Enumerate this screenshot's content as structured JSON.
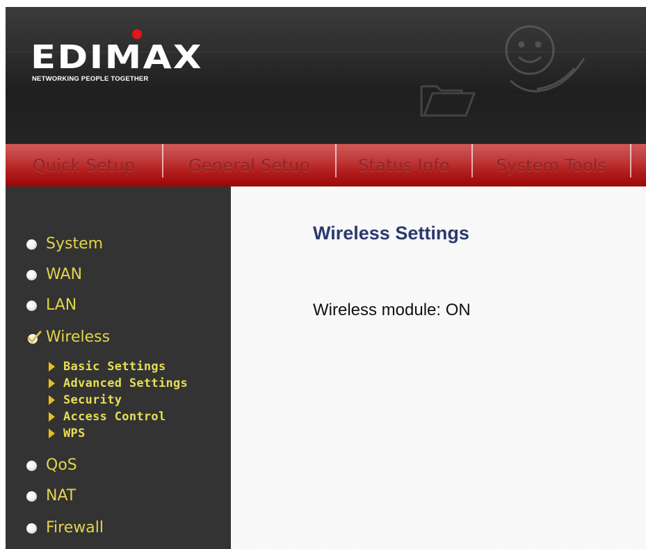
{
  "brand": {
    "logo": "EDIMAX",
    "tagline": "NETWORKING PEOPLE TOGETHER",
    "accent": "#e8141b"
  },
  "topnav": {
    "tabs": [
      {
        "label": "Quick Setup"
      },
      {
        "label": "General Setup"
      },
      {
        "label": "Status Info"
      },
      {
        "label": "System Tools"
      }
    ],
    "color": "#b11d1d"
  },
  "sidebar": {
    "items": [
      {
        "label": "System",
        "icon": "bullet-icon"
      },
      {
        "label": "WAN",
        "icon": "bullet-icon"
      },
      {
        "label": "LAN",
        "icon": "bullet-icon"
      },
      {
        "label": "Wireless",
        "icon": "checkmark-icon",
        "selected": true
      },
      {
        "label": "QoS",
        "icon": "bullet-icon"
      },
      {
        "label": "NAT",
        "icon": "bullet-icon"
      },
      {
        "label": "Firewall",
        "icon": "bullet-icon"
      }
    ],
    "wireless_sub": [
      {
        "label": "Basic Settings"
      },
      {
        "label": "Advanced Settings"
      },
      {
        "label": "Security"
      },
      {
        "label": "Access Control"
      },
      {
        "label": "WPS"
      }
    ],
    "label_color": "#e2d44a"
  },
  "main": {
    "title": "Wireless Settings",
    "status": "Wireless module: ON",
    "title_color": "#2b3a6e"
  }
}
